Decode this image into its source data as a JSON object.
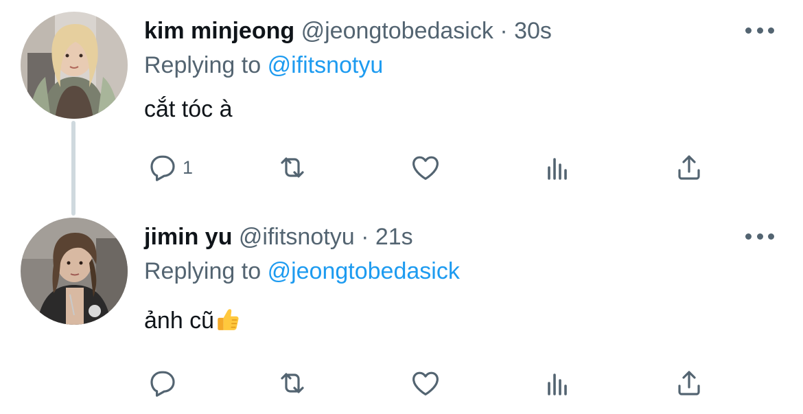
{
  "tweets": [
    {
      "name": "kim minjeong",
      "handle": "@jeongtobedasick",
      "separator": "·",
      "time": "30s",
      "replying_prefix": "Replying to",
      "replying_to": "@ifitsnotyu",
      "text": "cắt tóc à",
      "emoji": "",
      "reply_count": "1",
      "icons": [
        "reply-icon",
        "retweet-icon",
        "heart-icon",
        "views-icon",
        "share-icon",
        "more-icon"
      ]
    },
    {
      "name": "jimin yu",
      "handle": "@ifitsnotyu",
      "separator": "·",
      "time": "21s",
      "replying_prefix": "Replying to",
      "replying_to": "@jeongtobedasick",
      "text": "ảnh cũ",
      "emoji": "thumbs-up",
      "reply_count": "",
      "icons": [
        "reply-icon",
        "retweet-icon",
        "heart-icon",
        "views-icon",
        "share-icon",
        "more-icon"
      ]
    }
  ],
  "colors": {
    "text": "#0f1419",
    "secondary": "#536471",
    "link": "#1d9bf0",
    "thread_line": "#cfd9de",
    "background": "#ffffff"
  }
}
